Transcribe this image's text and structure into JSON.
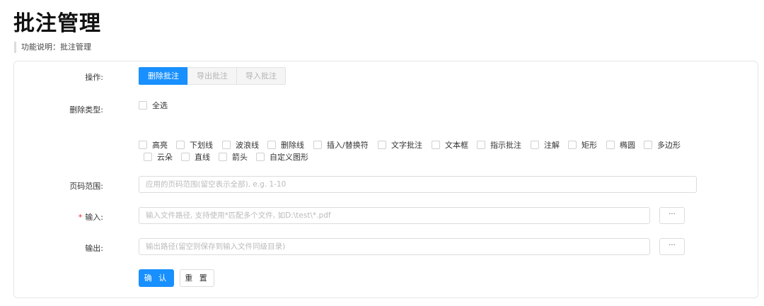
{
  "page": {
    "title": "批注管理",
    "description": "功能说明：批注管理"
  },
  "form": {
    "operation": {
      "label": "操作:",
      "buttons": [
        "删除批注",
        "导出批注",
        "导入批注"
      ],
      "selected": "删除批注"
    },
    "delete_type": {
      "label": "删除类型:",
      "select_all": "全选",
      "options": [
        "高亮",
        "下划线",
        "波浪线",
        "删除线",
        "插入/替换符",
        "文字批注",
        "文本框",
        "指示批注",
        "注解",
        "矩形",
        "椭圆",
        "多边形",
        "云朵",
        "直线",
        "箭头",
        "自定义图形"
      ]
    },
    "page_range": {
      "label": "页码范围:",
      "placeholder": "应用的页码范围(留空表示全部), e.g. 1-10"
    },
    "input": {
      "required_mark": "*",
      "label": "输入:",
      "placeholder": "输入文件路径, 支持使用*匹配多个文件, 如D:\\test\\*.pdf",
      "browse_label": "···"
    },
    "output": {
      "label": "输出:",
      "placeholder": "输出路径(留空则保存到输入文件同级目录)",
      "browse_label": "···"
    },
    "confirm_label": "确 认",
    "reset_label": "重 置"
  },
  "colors": {
    "accent": "#1890ff",
    "required": "#f5222d",
    "disabled_text": "#b3b3b3"
  }
}
